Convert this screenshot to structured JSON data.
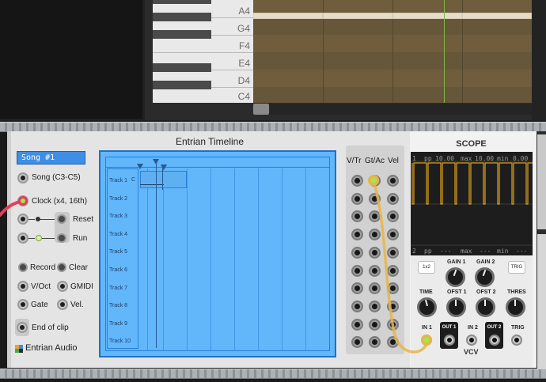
{
  "piano_roll": {
    "notes": [
      "A4",
      "G4",
      "F4",
      "E4",
      "D4",
      "C4"
    ]
  },
  "entrian": {
    "title": "Entrian Timeline",
    "song_display": "Song #1",
    "labels": {
      "song": "Song (C3-C5)",
      "clock": "Clock (x4, 16th)",
      "reset": "Reset",
      "run": "Run",
      "record": "Record",
      "clear": "Clear",
      "voct": "V/Oct",
      "gmidi": "GMIDI",
      "gate": "Gate",
      "vel": "Vel.",
      "end_of_clip": "End of clip"
    },
    "logo": "Entrian Audio",
    "tracks": [
      "Track 1",
      "Track 2",
      "Track 3",
      "Track 4",
      "Track 5",
      "Track 6",
      "Track 7",
      "Track 8",
      "Track 9",
      "Track 10"
    ],
    "clip_label": "C",
    "columns": [
      "V/Tr",
      "Gt/Ac",
      "Vel"
    ]
  },
  "scope": {
    "title": "SCOPE",
    "readout_top": {
      "ch": "1",
      "pp": "pp",
      "pp_val": "10.00",
      "max": "max",
      "max_val": "10.00",
      "min": "min",
      "min_val": "0.00"
    },
    "readout_bottom": {
      "ch": "2",
      "pp": "pp",
      "pp_val": "---",
      "max": "max",
      "max_val": "---",
      "min": "min",
      "min_val": "---"
    },
    "labels": {
      "x2": "1x2",
      "gain1": "GAIN 1",
      "gain2": "GAIN 2",
      "trig": "TRIG",
      "time": "TIME",
      "ofst1": "OFST 1",
      "ofst2": "OFST 2",
      "thres": "THRES",
      "in1": "IN 1",
      "out1": "OUT 1",
      "in2": "IN 2",
      "out2": "OUT 2",
      "trig_in": "TRIG"
    },
    "brand": "VCV"
  },
  "colors": {
    "timeline_bg": "#62b6fa",
    "cable_red": "#e0405a",
    "cable_yellow": "#e8b54a",
    "scope_wave": "#e0a21a"
  }
}
